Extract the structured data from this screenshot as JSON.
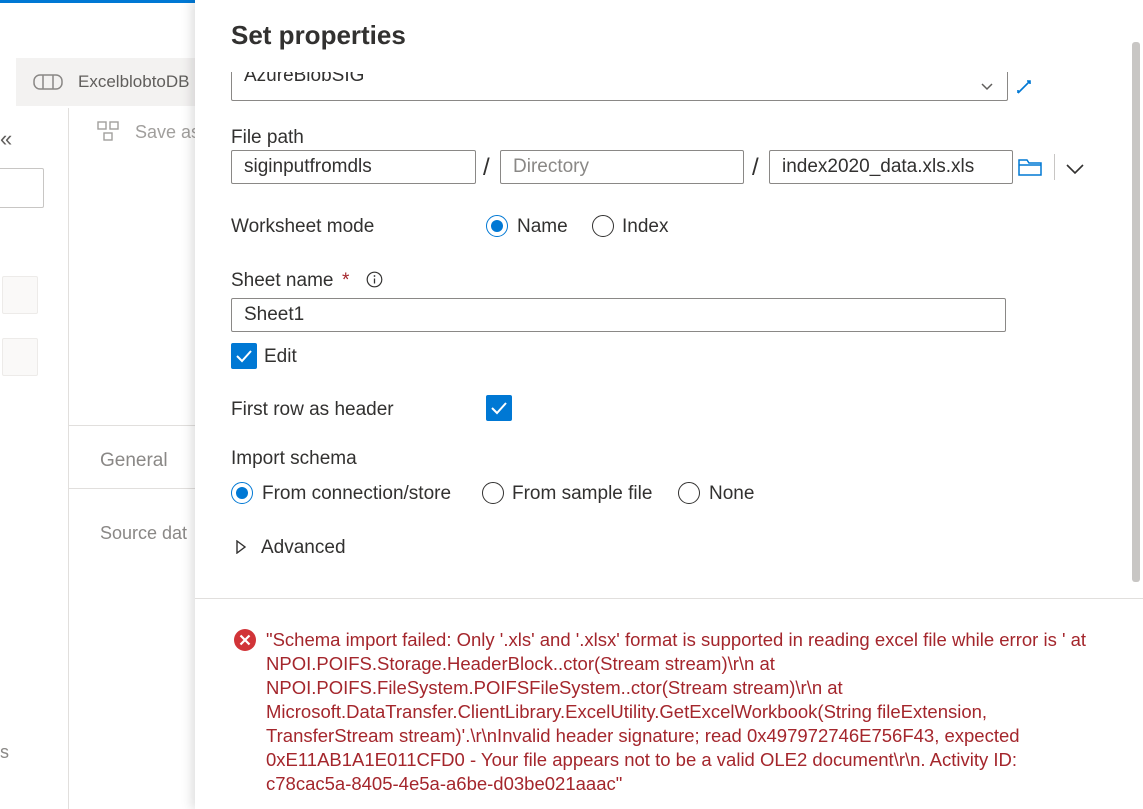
{
  "background": {
    "pipeline_tab": "ExcelblobtoDB",
    "save_as": "Save as",
    "general_tab": "General",
    "source_data": "Source dat",
    "left_fragment": "s",
    "collapse_glyph": "«",
    "accent_color": "#0078d4"
  },
  "panel": {
    "title": "Set properties",
    "linked_service": {
      "value": "AzureBlobSIG"
    },
    "file_path": {
      "label": "File path",
      "container": "siginputfromdls",
      "directory_placeholder": "Directory",
      "file": "index2020_data.xls.xls",
      "separator": "/"
    },
    "worksheet_mode": {
      "label": "Worksheet mode",
      "options": [
        "Name",
        "Index"
      ],
      "selected": "Name"
    },
    "sheet_name": {
      "label": "Sheet name",
      "required_mark": "*",
      "value": "Sheet1",
      "edit_label": "Edit",
      "edit_checked": true
    },
    "first_row_header": {
      "label": "First row as header",
      "checked": true
    },
    "import_schema": {
      "label": "Import schema",
      "options": [
        "From connection/store",
        "From sample file",
        "None"
      ],
      "selected": "From connection/store"
    },
    "advanced": {
      "label": "Advanced"
    },
    "error": {
      "color": "#a4262c",
      "message": "\"Schema import failed: Only '.xls' and '.xlsx' format is supported in reading excel file while error is ' at NPOI.POIFS.Storage.HeaderBlock..ctor(Stream stream)\\r\\n at\nNPOI.POIFS.FileSystem.POIFSFileSystem..ctor(Stream stream)\\r\\n at\nMicrosoft.DataTransfer.ClientLibrary.ExcelUtility.GetExcelWorkbook(String fileExtension,\nTransferStream stream)'.\\r\\nInvalid header signature; read 0x497972746E756F43, expected\n0xE11AB1A1E011CFD0 - Your file appears not to be a valid OLE2 document\\r\\n. Activity ID:\nc78cac5a-8405-4e5a-a6be-d03be021aaac\""
    }
  }
}
